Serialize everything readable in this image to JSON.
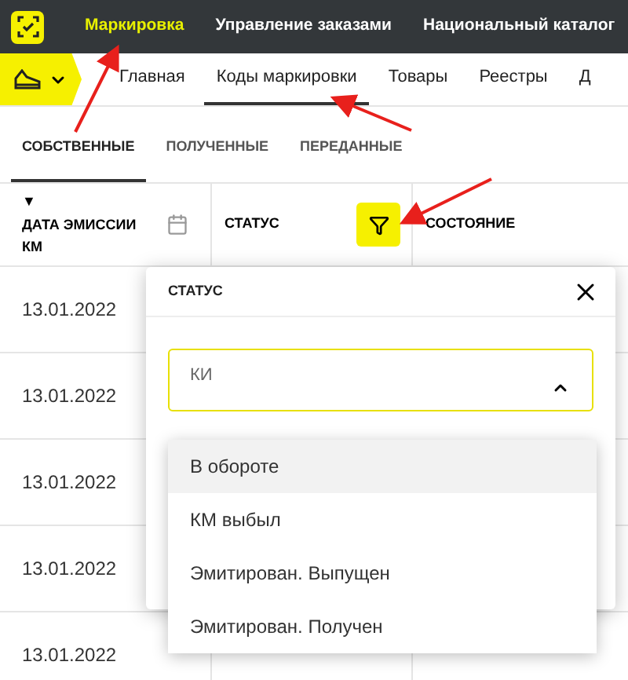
{
  "top_nav": {
    "items": [
      {
        "label": "Маркировка",
        "selected": true
      },
      {
        "label": "Управление заказами",
        "selected": false
      },
      {
        "label": "Национальный каталог",
        "selected": false
      }
    ]
  },
  "sub_nav": {
    "items": [
      {
        "label": "Главная",
        "selected": false
      },
      {
        "label": "Коды маркировки",
        "selected": true
      },
      {
        "label": "Товары",
        "selected": false
      },
      {
        "label": "Реестры",
        "selected": false
      },
      {
        "label": "Д",
        "selected": false
      }
    ]
  },
  "tabs": [
    {
      "label": "СОБСТВЕННЫЕ",
      "selected": true
    },
    {
      "label": "ПОЛУЧЕННЫЕ",
      "selected": false
    },
    {
      "label": "ПЕРЕДАННЫЕ",
      "selected": false
    }
  ],
  "table": {
    "columns": [
      {
        "label": "ДАТА ЭМИССИИ КМ",
        "sort": "▼"
      },
      {
        "label": "СТАТУС",
        "filter_active": true
      },
      {
        "label": "СОСТОЯНИЕ"
      }
    ],
    "rows": [
      {
        "date": "13.01.2022"
      },
      {
        "date": "13.01.2022"
      },
      {
        "date": "13.01.2022"
      },
      {
        "date": "13.01.2022"
      },
      {
        "date": "13.01.2022"
      }
    ]
  },
  "filter_popup": {
    "title": "СТАТУС",
    "select": {
      "placeholder": "КИ",
      "expanded": true
    },
    "options": [
      {
        "label": "В обороте",
        "selected": true
      },
      {
        "label": "КМ выбыл",
        "selected": false
      },
      {
        "label": "Эмитирован. Выпущен",
        "selected": false
      },
      {
        "label": "Эмитирован. Получен",
        "selected": false
      }
    ]
  }
}
